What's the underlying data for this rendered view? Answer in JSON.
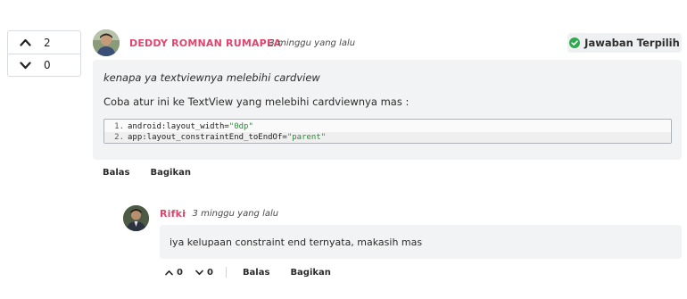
{
  "vote": {
    "up_count": "2",
    "down_count": "0"
  },
  "answer": {
    "author": "DEDDY ROMNAN RUMAPEA",
    "separator": "·",
    "time": "3 minggu yang lalu",
    "badge_label": "Jawaban Terpilih",
    "quote": "kenapa ya textviewnya melebihi cardview",
    "body": "Coba atur ini ke TextView yang melebihi cardviewnya mas :",
    "code": [
      {
        "num": "1.",
        "key": "android:layout_width=",
        "value": "\"0dp\""
      },
      {
        "num": "2.",
        "key": "app:layout_constraintEnd_toEndOf=",
        "value": "\"parent\""
      }
    ],
    "reply_label": "Balas",
    "share_label": "Bagikan"
  },
  "reply": {
    "author": "Rifki",
    "separator": "·",
    "time": "3 minggu yang lalu",
    "text": "iya kelupaan constraint end ternyata, makasih mas",
    "up_count": "0",
    "down_count": "0",
    "reply_label": "Balas",
    "share_label": "Bagikan"
  },
  "colors": {
    "author": "#e0456e",
    "check": "#2fa84f",
    "code_string": "#2a8a3a"
  }
}
